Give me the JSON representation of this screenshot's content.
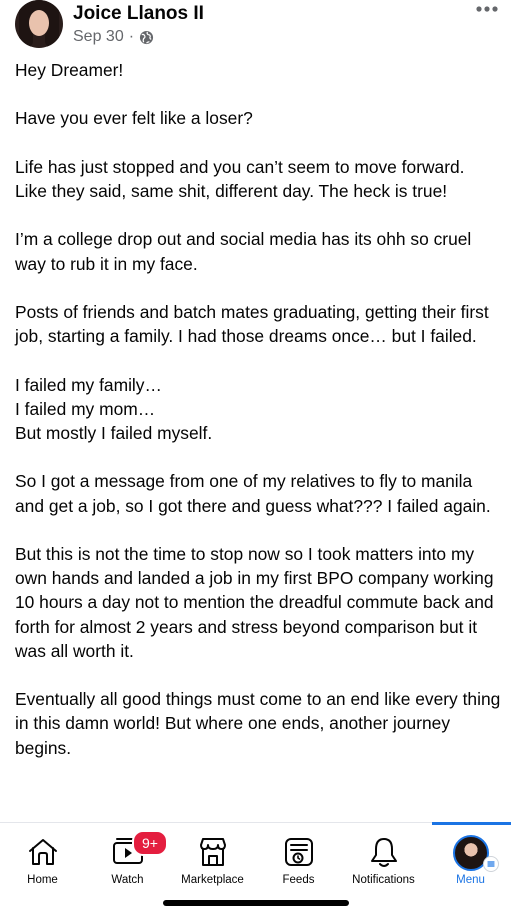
{
  "post": {
    "author": "Joice Llanos II",
    "date": "Sep 30",
    "separator": "·",
    "privacy_icon": "globe-icon",
    "more_icon": "more-horizontal-icon",
    "paragraphs": [
      "Hey Dreamer!",
      "Have you ever felt like a loser?",
      "Life has just stopped and you can’t seem to move forward. Like they said, same shit, different day. The heck is true!",
      "I’m a college drop out and social media has its ohh so cruel way to rub it in my face.",
      "Posts of friends and batch mates graduating, getting their first job, starting a family. I had those dreams once… but I failed.",
      "I failed my family…\nI failed my mom…\nBut mostly I failed myself.",
      "So I got a message from one of my relatives to fly to manila and get a job, so I got there and guess what??? I failed again.",
      "But this is not the time to stop now so I took matters into my own hands and landed a job in my first BPO company working 10 hours a day not to mention the dreadful commute back and forth for almost 2 years and stress beyond comparison but it was all worth it.",
      "Eventually all good things must come to an end like every thing in this damn world! But where one ends, another journey begins."
    ]
  },
  "nav": {
    "items": [
      {
        "label": "Home",
        "icon": "home-icon"
      },
      {
        "label": "Watch",
        "icon": "video-icon",
        "badge": "9+"
      },
      {
        "label": "Marketplace",
        "icon": "storefront-icon"
      },
      {
        "label": "Feeds",
        "icon": "feeds-icon"
      },
      {
        "label": "Notifications",
        "icon": "bell-icon"
      },
      {
        "label": "Menu",
        "icon": "profile-avatar-icon"
      }
    ],
    "active": "Menu"
  },
  "colors": {
    "accent": "#1b74e4",
    "badge": "#e41e3f",
    "meta_text": "#65676b"
  }
}
